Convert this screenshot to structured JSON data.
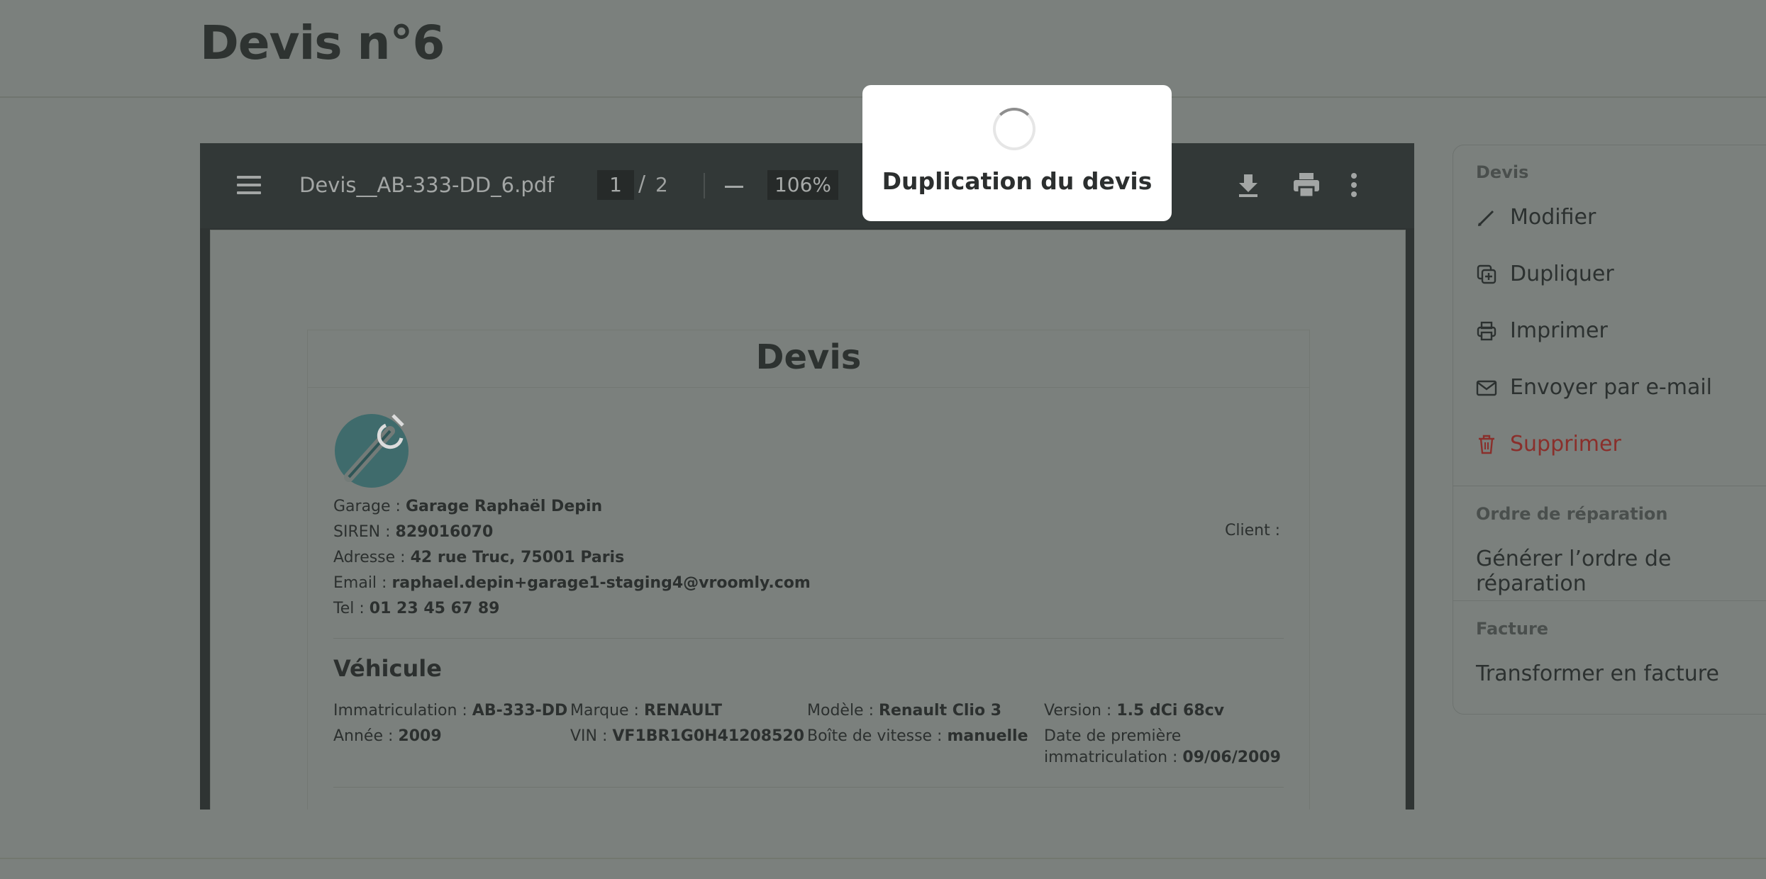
{
  "page": {
    "title": "Devis n°6"
  },
  "viewer": {
    "filename": "Devis__AB-333-DD_6.pdf",
    "current_page": "1",
    "page_separator": "/",
    "total_pages": "2",
    "zoom": "106%"
  },
  "document": {
    "title": "Devis",
    "garage": {
      "label": "Garage :",
      "value": "Garage Raphaël Depin"
    },
    "siren": {
      "label": "SIREN :",
      "value": "829016070"
    },
    "address": {
      "label": "Adresse :",
      "value": "42 rue Truc, 75001 Paris"
    },
    "email": {
      "label": "Email :",
      "value": "raphael.depin+garage1-staging4@vroomly.com"
    },
    "tel": {
      "label": "Tel :",
      "value": "01 23 45 67 89"
    },
    "client_label": "Client :",
    "vehicle": {
      "title": "Véhicule",
      "immatriculation": {
        "label": "Immatriculation :",
        "value": "AB-333-DD"
      },
      "marque": {
        "label": "Marque :",
        "value": "RENAULT"
      },
      "modele": {
        "label": "Modèle :",
        "value": "Renault Clio 3"
      },
      "version": {
        "label": "Version :",
        "value": "1.5 dCi 68cv"
      },
      "annee": {
        "label": "Année :",
        "value": "2009"
      },
      "vin": {
        "label": "VIN :",
        "value": "VF1BR1G0H41208520"
      },
      "boite": {
        "label": "Boîte de vitesse :",
        "value": "manuelle"
      },
      "date_immat_line1": "Date de première",
      "date_immat_label": "immatriculation :",
      "date_immat_value": "09/06/2009"
    }
  },
  "side_menu": {
    "devis_section": "Devis",
    "modifier": "Modifier",
    "dupliquer": "Dupliquer",
    "imprimer": "Imprimer",
    "envoyer": "Envoyer par e-mail",
    "supprimer": "Supprimer",
    "ordre_section": "Ordre de réparation",
    "generer": "Générer l’ordre de réparation",
    "facture_section": "Facture",
    "transformer": "Transformer en facture"
  },
  "modal": {
    "text": "Duplication du devis"
  },
  "colors": {
    "danger": "#8a2f2b",
    "overlay": "#7b807d",
    "modal_bg": "#ffffff"
  }
}
